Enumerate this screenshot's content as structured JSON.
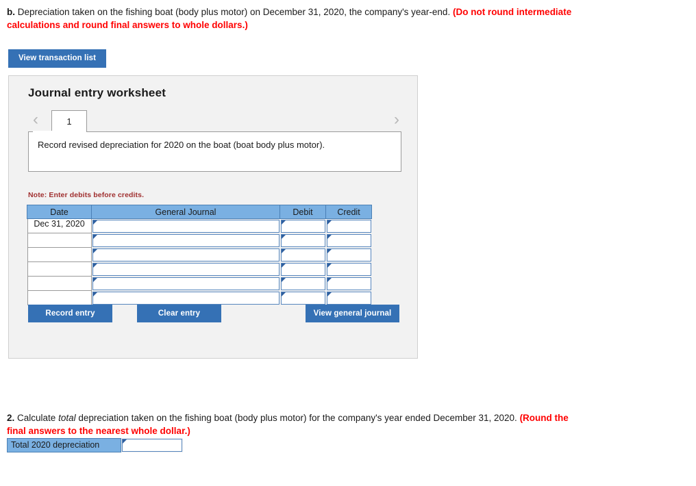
{
  "question_b": {
    "label": "b.",
    "text_before": " Depreciation taken on the fishing boat (body plus motor) on December 31, 2020, the company's year-end. ",
    "instruction_red": "(Do not round intermediate calculations and round final answers to whole dollars.)"
  },
  "toolbar": {
    "view_transaction_list_label": "View transaction list"
  },
  "worksheet": {
    "title": "Journal entry worksheet",
    "prev_icon": "chevron-left-icon",
    "next_icon": "chevron-right-icon",
    "tabs": [
      {
        "label": "1",
        "active": true
      }
    ],
    "description": "Record revised depreciation for 2020 on the boat (boat body plus motor).",
    "note": "Note: Enter debits before credits.",
    "table": {
      "columns": [
        "Date",
        "General Journal",
        "Debit",
        "Credit"
      ],
      "rows": [
        {
          "date": "Dec 31, 2020",
          "general_journal": "",
          "debit": "",
          "credit": ""
        },
        {
          "date": "",
          "general_journal": "",
          "debit": "",
          "credit": ""
        },
        {
          "date": "",
          "general_journal": "",
          "debit": "",
          "credit": ""
        },
        {
          "date": "",
          "general_journal": "",
          "debit": "",
          "credit": ""
        },
        {
          "date": "",
          "general_journal": "",
          "debit": "",
          "credit": ""
        },
        {
          "date": "",
          "general_journal": "",
          "debit": "",
          "credit": ""
        }
      ]
    },
    "buttons": {
      "record_entry": "Record entry",
      "clear_entry": "Clear entry",
      "view_general_journal": "View general journal"
    }
  },
  "question_2": {
    "label": "2.",
    "text_part1": " Calculate ",
    "text_italic": "total",
    "text_part2": " depreciation taken on the fishing boat (body plus motor) for the company's year ended December 31, 2020. ",
    "instruction_red": "(Round the final answers to the nearest whole dollar.)",
    "total_label": "Total 2020 depreciation",
    "total_value": ""
  },
  "colors": {
    "button_blue": "#3571b5",
    "header_blue": "#7ab0e2",
    "panel_gray": "#f2f2f2",
    "red": "#ff0000",
    "note_red": "#a03030",
    "input_border": "#5585bd"
  }
}
